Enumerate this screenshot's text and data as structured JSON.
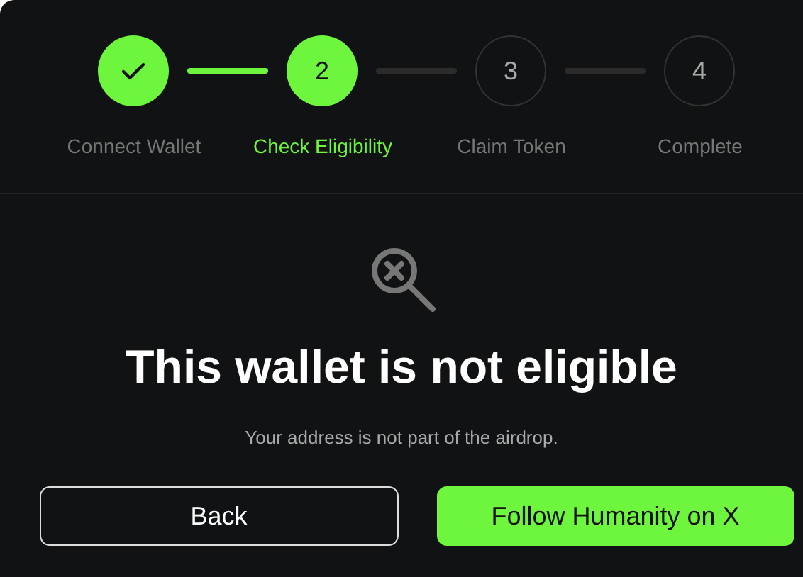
{
  "steps": [
    {
      "completed": true,
      "selected": false,
      "label": "Connect Wallet"
    },
    {
      "completed": false,
      "selected": true,
      "number": "2",
      "label": "Check Eligibility"
    },
    {
      "completed": false,
      "selected": false,
      "number": "3",
      "label": "Claim Token"
    },
    {
      "completed": false,
      "selected": false,
      "number": "4",
      "label": "Complete"
    }
  ],
  "result": {
    "title": "This wallet is not eligible",
    "message": "Your address is not part of the airdrop."
  },
  "buttons": [
    {
      "kind": "outline",
      "label": "Back"
    },
    {
      "kind": "primary",
      "label": "Follow Humanity on X"
    }
  ]
}
